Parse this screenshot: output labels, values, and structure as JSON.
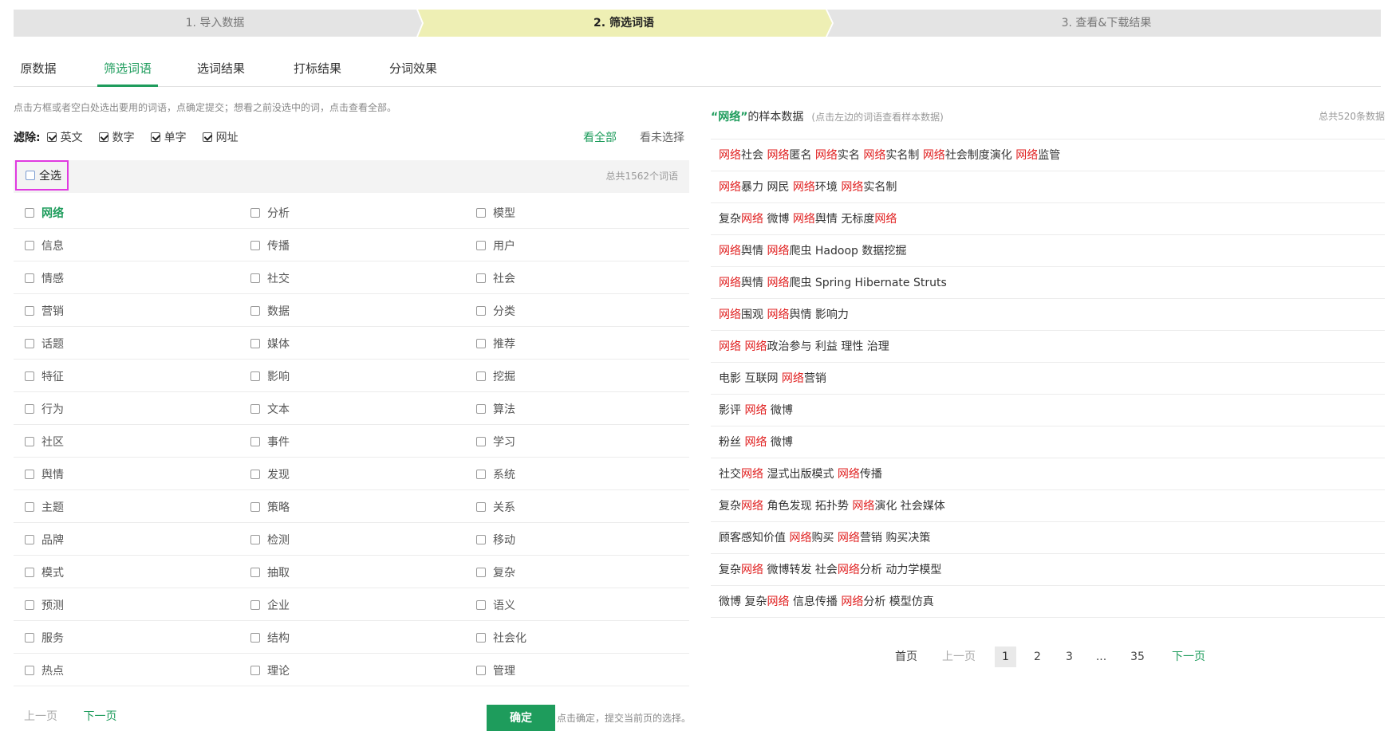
{
  "steps": [
    {
      "label": "1. 导入数据",
      "active": false
    },
    {
      "label": "2. 筛选词语",
      "active": true
    },
    {
      "label": "3. 查看&下载结果",
      "active": false
    }
  ],
  "tabs": [
    "原数据",
    "筛选词语",
    "选词结果",
    "打标结果",
    "分词效果"
  ],
  "hint": "点击方框或者空白处选出要用的词语，点确定提交；想看之前没选中的词，点击查看全部。",
  "filter": {
    "title": "滤除:",
    "options": [
      {
        "label": "英文",
        "checked": true
      },
      {
        "label": "数字",
        "checked": true
      },
      {
        "label": "单字",
        "checked": true
      },
      {
        "label": "网址",
        "checked": true
      }
    ]
  },
  "view_all": "看全部",
  "view_unselected": "看未选择",
  "select_all": "全选",
  "total_words": "总共1562个词语",
  "words": [
    [
      "网络",
      "分析",
      "模型"
    ],
    [
      "信息",
      "传播",
      "用户"
    ],
    [
      "情感",
      "社交",
      "社会"
    ],
    [
      "营销",
      "数据",
      "分类"
    ],
    [
      "话题",
      "媒体",
      "推荐"
    ],
    [
      "特征",
      "影响",
      "挖掘"
    ],
    [
      "行为",
      "文本",
      "算法"
    ],
    [
      "社区",
      "事件",
      "学习"
    ],
    [
      "舆情",
      "发现",
      "系统"
    ],
    [
      "主题",
      "策略",
      "关系"
    ],
    [
      "品牌",
      "检测",
      "移动"
    ],
    [
      "模式",
      "抽取",
      "复杂"
    ],
    [
      "预测",
      "企业",
      "语义"
    ],
    [
      "服务",
      "结构",
      "社会化"
    ],
    [
      "热点",
      "理论",
      "管理"
    ]
  ],
  "selected_word": "网络",
  "left_pager": {
    "prev": "上一页",
    "next": "下一页"
  },
  "confirm": {
    "label": "确定",
    "hint": "点击确定，提交当前页的选择。"
  },
  "sample": {
    "keyword": "“网络”",
    "title_suffix": "的样本数据",
    "subtitle": "(点击左边的词语查看样本数据)",
    "total": "总共520条数据",
    "rows": [
      "网络社会 网络匿名 网络实名 网络实名制 网络社会制度演化 网络监管",
      "网络暴力 网民 网络环境 网络实名制",
      "复杂网络 微博 网络舆情 无标度网络",
      "网络舆情 网络爬虫 Hadoop 数据挖掘",
      "网络舆情 网络爬虫 Spring Hibernate Struts",
      "网络围观 网络舆情 影响力",
      "网络 网络政治参与 利益 理性 治理",
      "电影 互联网 网络营销",
      "影评 网络 微博",
      "粉丝 网络 微博",
      "社交网络 湿式出版模式 网络传播",
      "复杂网络 角色发现 拓扑势 网络演化 社会媒体",
      "顾客感知价值 网络购买 网络营销 购买决策",
      "复杂网络 微博转发 社会网络分析 动力学模型",
      "微博 复杂网络 信息传播 网络分析 模型仿真"
    ]
  },
  "pager": {
    "first": "首页",
    "prev": "上一页",
    "pages": [
      "1",
      "2",
      "3",
      "...",
      "35"
    ],
    "current": "1",
    "next": "下一页"
  },
  "colors": {
    "accent": "#1e9c5c",
    "highlight": "#e02020",
    "step_active": "#eeefb4",
    "step_inactive": "#e4e4e4",
    "select_all_border": "#e03ae0"
  }
}
